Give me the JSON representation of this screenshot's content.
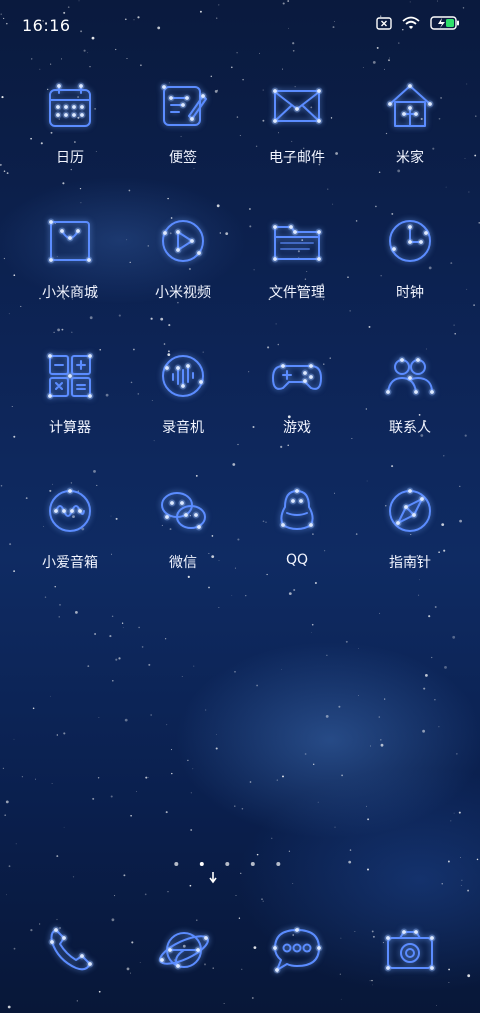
{
  "status_bar": {
    "time": "16:16",
    "icons": [
      "sim-disabled-icon",
      "wifi-icon",
      "battery-charging-icon"
    ]
  },
  "apps": [
    {
      "label": "日历",
      "icon": "calendar-icon"
    },
    {
      "label": "便签",
      "icon": "notes-icon"
    },
    {
      "label": "电子邮件",
      "icon": "email-icon"
    },
    {
      "label": "米家",
      "icon": "home-icon"
    },
    {
      "label": "小米商城",
      "icon": "shopping-bag-icon"
    },
    {
      "label": "小米视频",
      "icon": "video-play-icon"
    },
    {
      "label": "文件管理",
      "icon": "folder-icon"
    },
    {
      "label": "时钟",
      "icon": "clock-icon"
    },
    {
      "label": "计算器",
      "icon": "calculator-icon"
    },
    {
      "label": "录音机",
      "icon": "recorder-icon"
    },
    {
      "label": "游戏",
      "icon": "gamepad-icon"
    },
    {
      "label": "联系人",
      "icon": "contacts-icon"
    },
    {
      "label": "小爱音箱",
      "icon": "speaker-wave-icon"
    },
    {
      "label": "微信",
      "icon": "wechat-icon"
    },
    {
      "label": "QQ",
      "icon": "qq-penguin-icon"
    },
    {
      "label": "指南针",
      "icon": "compass-icon"
    }
  ],
  "page_indicator": {
    "count": 5,
    "current": 1
  },
  "dock": [
    {
      "icon": "phone-icon"
    },
    {
      "icon": "browser-icon"
    },
    {
      "icon": "messages-icon"
    },
    {
      "icon": "camera-icon"
    }
  ],
  "colors": {
    "icon_stroke": "#5b8cff",
    "icon_glow": "#9fc0ff",
    "star": "#ffffff"
  }
}
